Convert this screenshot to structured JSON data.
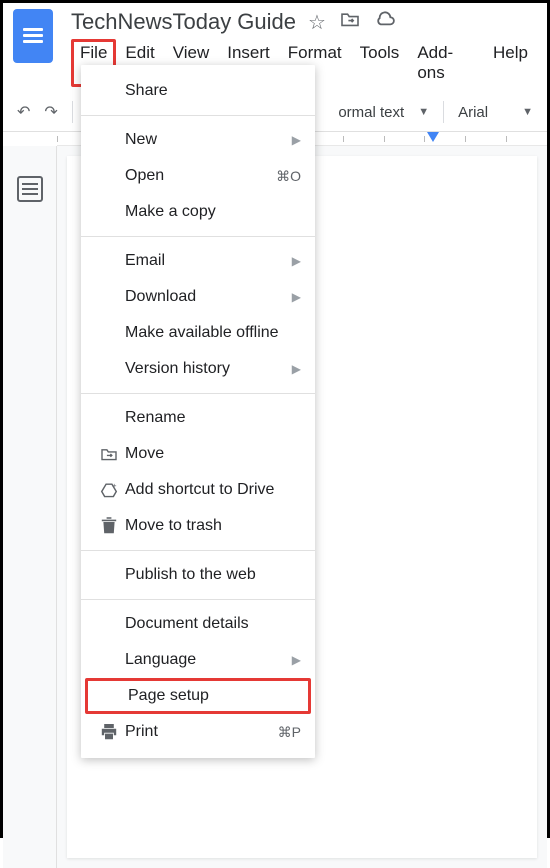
{
  "doc": {
    "title": "TechNewsToday Guide"
  },
  "menubar": {
    "file": "File",
    "edit": "Edit",
    "view": "View",
    "insert": "Insert",
    "format": "Format",
    "tools": "Tools",
    "addons": "Add-ons",
    "help": "Help"
  },
  "toolbar": {
    "style": "ormal text",
    "font": "Arial"
  },
  "file_menu": {
    "share": "Share",
    "new": "New",
    "open": "Open",
    "open_shortcut": "⌘O",
    "make_copy": "Make a copy",
    "email": "Email",
    "download": "Download",
    "offline": "Make available offline",
    "version_history": "Version history",
    "rename": "Rename",
    "move": "Move",
    "add_shortcut": "Add shortcut to Drive",
    "trash": "Move to trash",
    "publish": "Publish to the web",
    "details": "Document details",
    "language": "Language",
    "page_setup": "Page setup",
    "print": "Print",
    "print_shortcut": "⌘P"
  },
  "page": {
    "cursor": ".|"
  }
}
